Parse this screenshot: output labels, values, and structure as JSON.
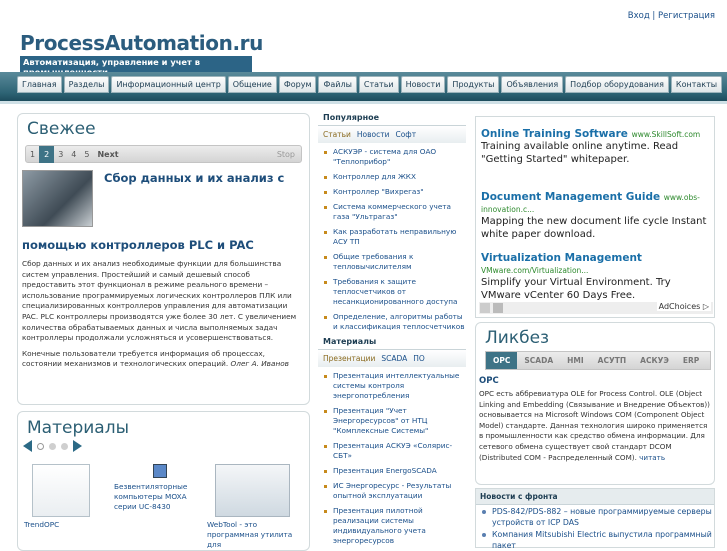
{
  "header": {
    "login": "Вход",
    "sep": " | ",
    "register": "Регистрация",
    "logo": "ProcessAutomation.ru",
    "tagline": "Автоматизация, управление и учет в промышленности"
  },
  "nav": [
    "Главная",
    "Разделы",
    "Информационный центр",
    "Общение",
    "Форум",
    "Файлы",
    "Статьи",
    "Новости",
    "Продукты",
    "Объявления",
    "Подбор оборудования",
    "Контакты"
  ],
  "fresh": {
    "title": "Свежее",
    "pages": [
      "1",
      "2",
      "3",
      "4",
      "5"
    ],
    "current": "2",
    "next": "Next",
    "stop": "Stop",
    "article_title1": "Сбор данных и их анализ с",
    "article_title2": "помощью контроллеров PLC и PAC",
    "p1": "Сбор данных и их анализ необходимые функции для большинства систем управления. Простейший и самый дешевый способ предоставить этот функционал в режиме реального времени – использование программируемых логических контроллеров ПЛК или специализированных контроллеров управления для автоматизации PAC. PLC контроллеры производятся уже более 30 лет. С увеличением количества обрабатываемых данных и числа выполняемых задач контроллеры продолжали усложняться и усовершенствоваться.",
    "p2": "Конечные пользователи требуется информация об процессах, состоянии механизмов и технологических операций.",
    "author": "Олег А. Иванов"
  },
  "materials": {
    "title": "Материалы",
    "item1": "TrendOPC",
    "item2": "Безвентиляторные компьютеры MOXA серии UC-8430",
    "item3": "WebTool - это программная утилита для"
  },
  "popular": {
    "title": "Популярное",
    "tabs": [
      "Статьи",
      "Новости",
      "Софт"
    ],
    "items": [
      "АСКУЭР - система для ОАО \"Теплоприбор\"",
      "Контроллер для ЖКХ",
      "Контроллер \"Вихрегаз\"",
      "Система коммерческого учета газа \"Ультрагаз\"",
      "Как разработать неправильную АСУ ТП",
      "Общие требования к тепловычислителям",
      "Требования к защите теплосчетчиков от несанкционированного доступа",
      "Определение, алгоритмы работы и классификация теплосчетчиков"
    ]
  },
  "mat_list": {
    "title": "Материалы",
    "tabs": [
      "Презентации",
      "SCADA",
      "ПО"
    ],
    "items": [
      "Презентация интеллектуальные системы контроля энергопотребления",
      "Презентация \"Учет Энергоресурсов\" от НТЦ \"Комплексные Системы\"",
      "Презентация АСКУЭ «Солярис-СБТ»",
      "Презентация EnergoSCADA",
      "ИС Энергоресурс - Результаты опытной эксплуатации",
      "Презентация пилотной реализации системы индивидуального учета энергоресурсов"
    ]
  },
  "ads": [
    {
      "t": "Online Training Software",
      "u": "www.SkillSoft.com",
      "d": "Training available online anytime. Read \"Getting Started\" whitepaper."
    },
    {
      "t": "Document Management Guide",
      "u": "www.obs-innovation.c...",
      "d": "Mapping the new document life cycle Instant white paper download."
    },
    {
      "t": "Virtualization Management",
      "u": "VMware.com/Virtualization...",
      "d": "Simplify your Virtual Environment. Try VMware vCenter 60 Days Free."
    }
  ],
  "adchoices": "AdChoices ▷",
  "likbez": {
    "title": "Ликбез",
    "tabs": [
      "OPC",
      "SCADA",
      "HMI",
      "АСУТП",
      "АСКУЭ",
      "ERP"
    ],
    "heading": "OPC",
    "body": "OPC есть аббревиатура OLE for Process Control. OLE (Object Linking and Embedding (Связывание и Внедрение Объектов)) основывается на Microsoft Windows COM (Component Object Model) стандарте. Данная технология широко применяется в промышленности как средство обмена информации. Для сетевого обмена существует свой стандарт DCOM (Distributed COM - Распределенный COM).",
    "more": "читать"
  },
  "news": {
    "title": "Новости с фронта",
    "items": [
      "PDS-842/PDS-882 – новые программируемые серверы устройств от ICP DAS",
      "Компания Mitsubishi Electric выпустила программный пакет"
    ]
  }
}
